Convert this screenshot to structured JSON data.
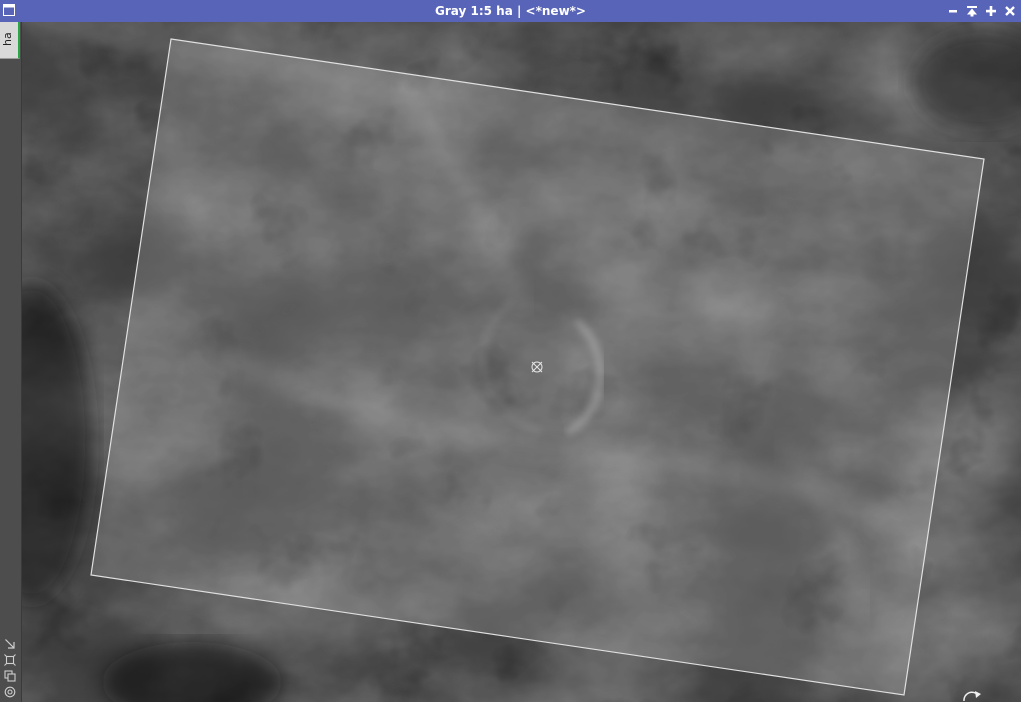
{
  "window": {
    "title": "Gray 1:5 ha | <*new*>"
  },
  "titlebar_buttons": {
    "minimize": "minimize-icon",
    "shade": "shade-icon",
    "maximize": "maximize-icon",
    "close": "close-icon"
  },
  "view_tab": {
    "label": "ha"
  },
  "side_toolbar": {
    "icons": [
      "drag-arrow-icon",
      "fit-view-icon",
      "clone-icon",
      "target-icon"
    ]
  },
  "canvas": {
    "image": "hydrogen-alpha nebula grayscale image",
    "overlay": "rotated crop rectangle",
    "center_marker": "crosshair-icon",
    "rotate_handle": "rotate-icon"
  },
  "colors": {
    "titlebar": "#5864b8",
    "title_text": "#ffffff",
    "crop_border": "#e0e0e0",
    "view_tab_indicator": "#27a844"
  }
}
